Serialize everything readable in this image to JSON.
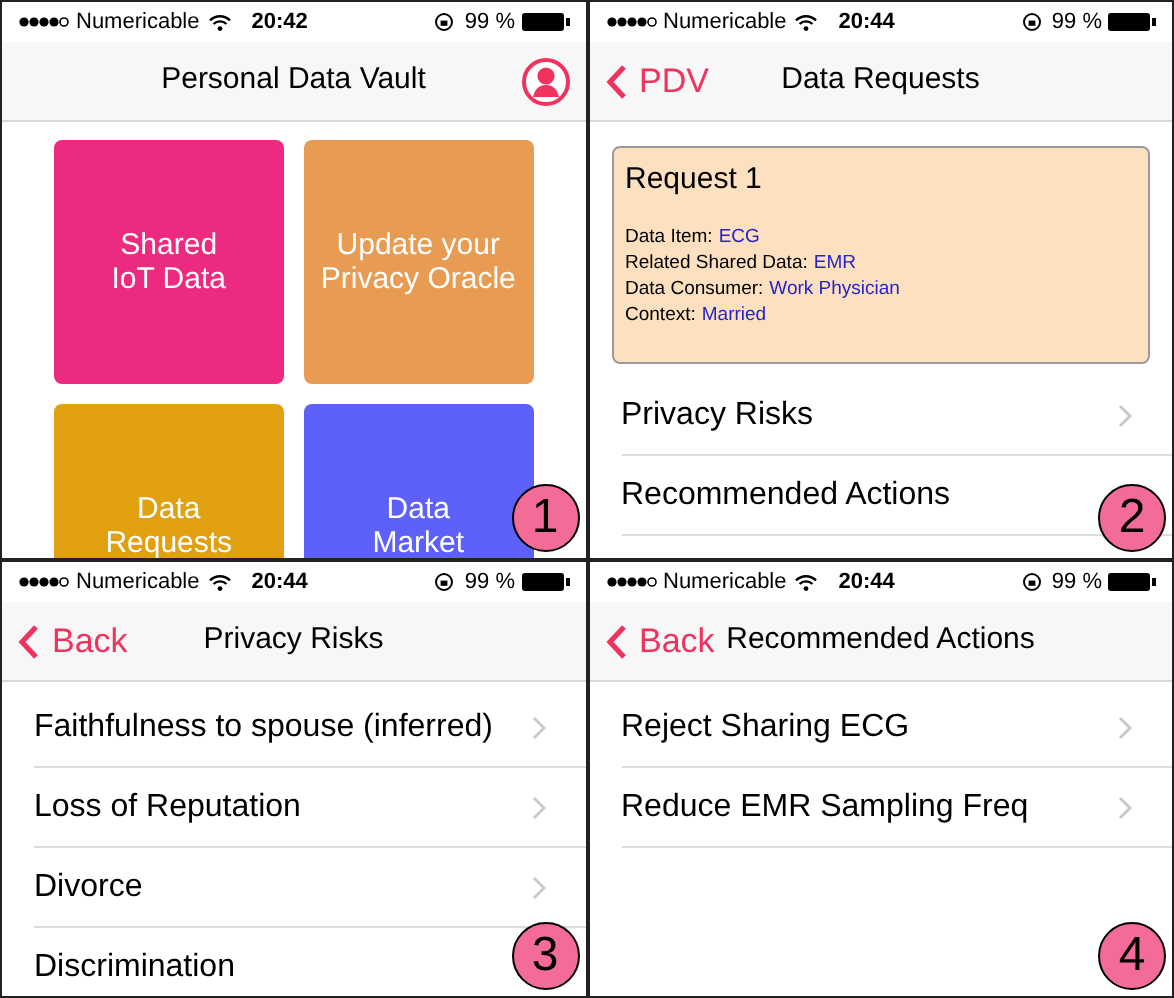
{
  "panels": [
    {
      "kind": "tiles",
      "status_bar": {
        "carrier": "Numericable",
        "time": "20:42",
        "battery": "99 %"
      },
      "nav": {
        "title": "Personal Data Vault",
        "profile": true
      },
      "badge": "1",
      "tiles": [
        {
          "label": "Shared\nIoT Data",
          "color": "#ec2a7f"
        },
        {
          "label": "Update your\nPrivacy Oracle",
          "color": "#e89b52"
        },
        {
          "label": "Data\nRequests",
          "color": "#e0a010"
        },
        {
          "label": "Data\nMarket",
          "color": "#5e60fa"
        }
      ]
    },
    {
      "kind": "request",
      "status_bar": {
        "carrier": "Numericable",
        "time": "20:44",
        "battery": "99 %"
      },
      "nav": {
        "back": "PDV",
        "title": "Data Requests"
      },
      "badge": "2",
      "card": {
        "title": "Request 1",
        "fields": [
          {
            "label": "Data Item:",
            "value": "ECG"
          },
          {
            "label": "Related Shared Data:",
            "value": "EMR"
          },
          {
            "label": "Data Consumer:",
            "value": "Work Physician"
          },
          {
            "label": "Context:",
            "value": "Married"
          }
        ]
      },
      "rows": [
        "Privacy Risks",
        "Recommended Actions"
      ]
    },
    {
      "kind": "list",
      "status_bar": {
        "carrier": "Numericable",
        "time": "20:44",
        "battery": "99 %"
      },
      "nav": {
        "back": "Back",
        "title": "Privacy Risks"
      },
      "badge": "3",
      "rows": [
        "Faithfulness to spouse (inferred)",
        "Loss of Reputation",
        "Divorce",
        "Discrimination"
      ]
    },
    {
      "kind": "list",
      "status_bar": {
        "carrier": "Numericable",
        "time": "20:44",
        "battery": "99 %"
      },
      "nav": {
        "back": "Back",
        "title": "Recommended Actions"
      },
      "badge": "4",
      "rows": [
        "Reject Sharing ECG",
        "Reduce EMR Sampling Freq"
      ]
    }
  ]
}
